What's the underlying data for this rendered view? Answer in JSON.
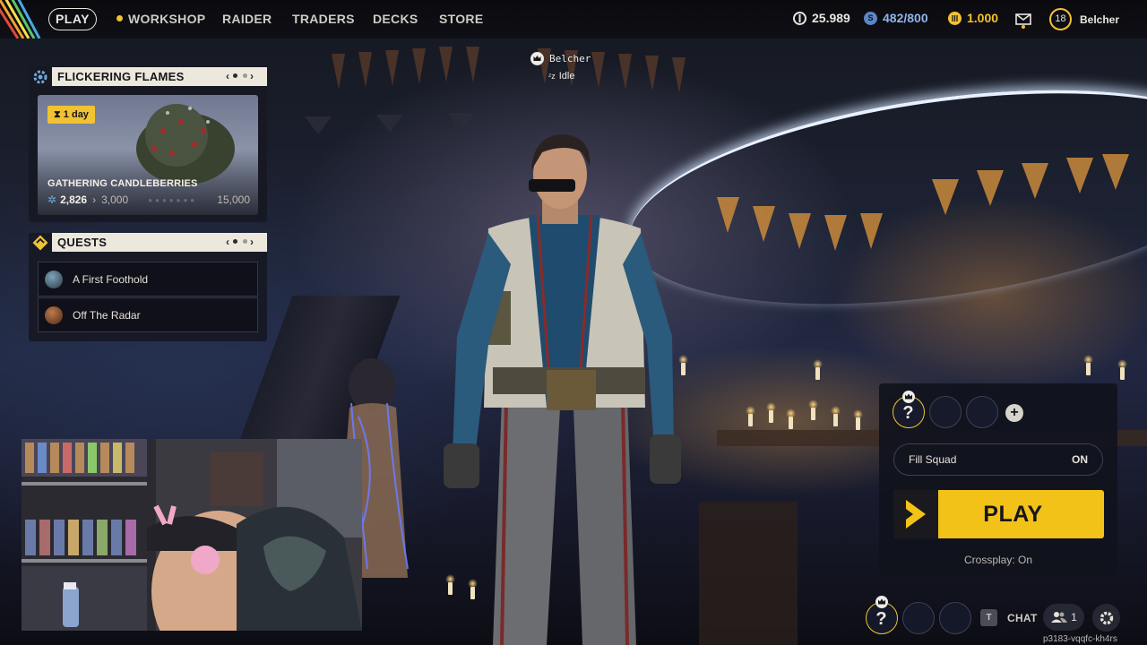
{
  "nav": {
    "play": "PLAY",
    "items": [
      "WORKSHOP",
      "RAIDER",
      "TRADERS",
      "DECKS",
      "STORE"
    ]
  },
  "currencies": {
    "coins": "25.989",
    "seeds": "482/800",
    "tokens": "1.000"
  },
  "profile": {
    "level": "18",
    "name": "Belcher"
  },
  "event_panel": {
    "title": "FLICKERING FLAMES",
    "timer": "1 day",
    "name": "GATHERING CANDLEBERRIES",
    "progress_current": "2,826",
    "progress_next": "3,000",
    "progress_max": "15,000"
  },
  "quests_panel": {
    "title": "QUESTS",
    "items": [
      "A First Foothold",
      "Off The Radar"
    ]
  },
  "player_tag": {
    "name": "Belcher",
    "status": "Idle"
  },
  "squad": {
    "fill_squad_label": "Fill Squad",
    "fill_squad_value": "ON",
    "play_label": "PLAY",
    "crossplay": "Crossplay: On"
  },
  "bottom": {
    "chat_key": "T",
    "chat_label": "CHAT",
    "friends_count": "1",
    "session_id": "p3183-vqqfc-kh4rs"
  },
  "colors": {
    "accent": "#f3c219",
    "panel_header": "#ece8dc",
    "panel_bg": "#161822"
  }
}
